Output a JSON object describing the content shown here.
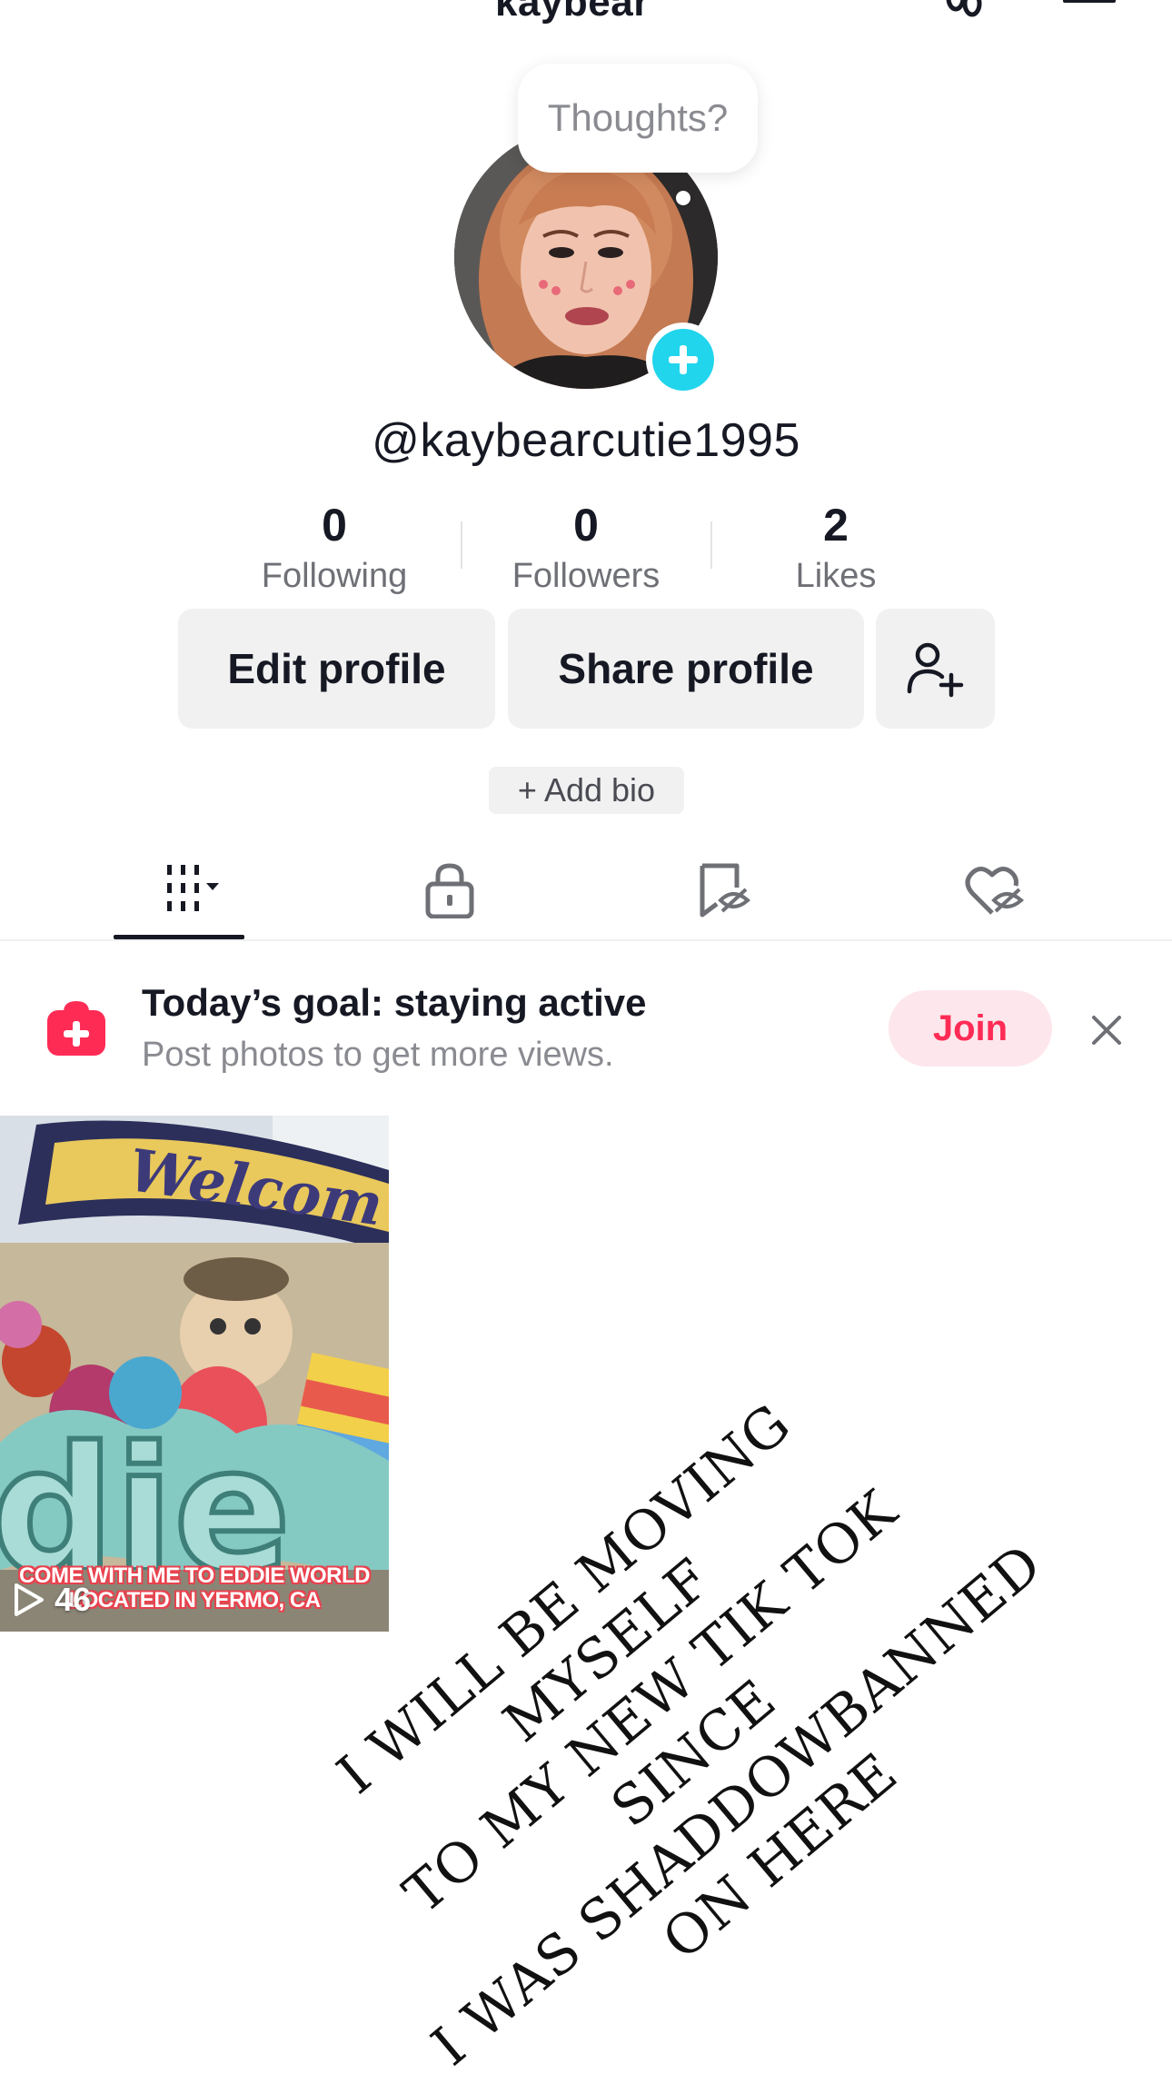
{
  "top_bar": {
    "account_name": "kaybear",
    "icons": [
      "chevron-down-icon",
      "footprint-icon",
      "menu-icon"
    ]
  },
  "profile": {
    "thought_bubble": "Thoughts?",
    "username": "@kaybearcutie1995",
    "stats": [
      {
        "value": "0",
        "label": "Following"
      },
      {
        "value": "0",
        "label": "Followers"
      },
      {
        "value": "2",
        "label": "Likes"
      }
    ],
    "buttons": {
      "edit": "Edit profile",
      "share": "Share profile"
    },
    "add_bio": "+ Add bio"
  },
  "tabs": [
    {
      "name": "videos",
      "icon": "grid-icon",
      "selected": true
    },
    {
      "name": "private",
      "icon": "lock-icon"
    },
    {
      "name": "favorites",
      "icon": "bookmark-hidden-icon"
    },
    {
      "name": "liked",
      "icon": "heart-hidden-icon"
    }
  ],
  "goal_banner": {
    "title": "Today’s goal: staying active",
    "subtitle": "Post photos to get more views.",
    "join_label": "Join"
  },
  "videos": [
    {
      "caption_line1": "COME WITH ME TO EDDIE WORLD",
      "caption_line2": "LOCATED IN YERMO, CA",
      "views": "46"
    }
  ],
  "overlay_text": {
    "line1": "I WILL BE MOVING MYSELF",
    "line2": "TO MY NEW TIK TOK SINCE",
    "line3": "I WAS SHADDOWBANNED",
    "line4": "ON HERE"
  },
  "colors": {
    "accent_cyan": "#20d5ec",
    "accent_red": "#fe2c55",
    "button_bg": "#f1f1f2",
    "text_primary": "#161823",
    "text_secondary": "#8a8b91"
  }
}
